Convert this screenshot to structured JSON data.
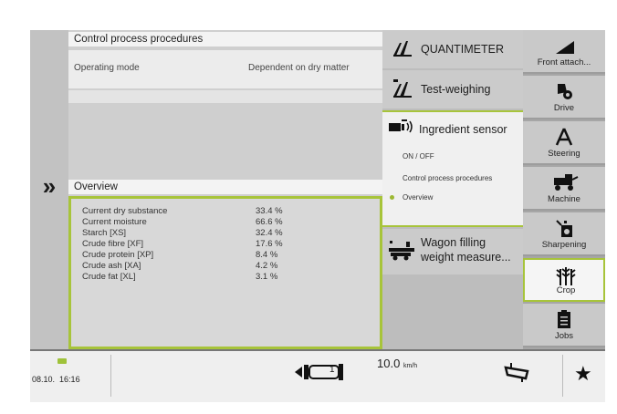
{
  "colors": {
    "accent": "#a7c43a",
    "panel_bg": "#d6d6d6"
  },
  "left": {
    "expand_icon": "double-chevron-right-icon",
    "expand_glyph": "»"
  },
  "main": {
    "control_section_title": "Control process procedures",
    "operating_mode_label": "Operating mode",
    "operating_mode_value": "Dependent on dry matter",
    "overview_section_title": "Overview",
    "overview_rows": [
      {
        "label": "Current dry substance",
        "value": "33.4 %"
      },
      {
        "label": "Current moisture",
        "value": "66.6 %"
      },
      {
        "label": "Starch [XS]",
        "value": "32.4 %"
      },
      {
        "label": "Crude fibre [XF]",
        "value": "17.6 %"
      },
      {
        "label": "Crude protein [XP]",
        "value": "8.4 %"
      },
      {
        "label": "Crude ash [XA]",
        "value": "4.2 %"
      },
      {
        "label": "Crude fat [XL]",
        "value": "3.1 %"
      }
    ]
  },
  "middle_menu": {
    "quantimeter": "QUANTIMETER",
    "test_weighing": "Test-weighing",
    "ingredient_sensor": "Ingredient sensor",
    "sub_items": [
      "ON / OFF",
      "Control process procedures",
      "Overview"
    ],
    "active_sub_index": 2,
    "wagon_line1": "Wagon filling",
    "wagon_line2": "weight measure..."
  },
  "right_menu": [
    {
      "label": "Front attach...",
      "icon": "front-attachment-icon"
    },
    {
      "label": "Drive",
      "icon": "drive-icon"
    },
    {
      "label": "Steering",
      "icon": "steering-icon"
    },
    {
      "label": "Machine",
      "icon": "machine-icon"
    },
    {
      "label": "Sharpening",
      "icon": "sharpening-icon"
    },
    {
      "label": "Crop",
      "icon": "crop-icon",
      "active": true
    },
    {
      "label": "Jobs",
      "icon": "jobs-icon"
    }
  ],
  "bottom": {
    "date": "08.10.",
    "time": "16:16",
    "gear": "1",
    "speed_value": "10.0",
    "speed_unit": "km/h"
  }
}
